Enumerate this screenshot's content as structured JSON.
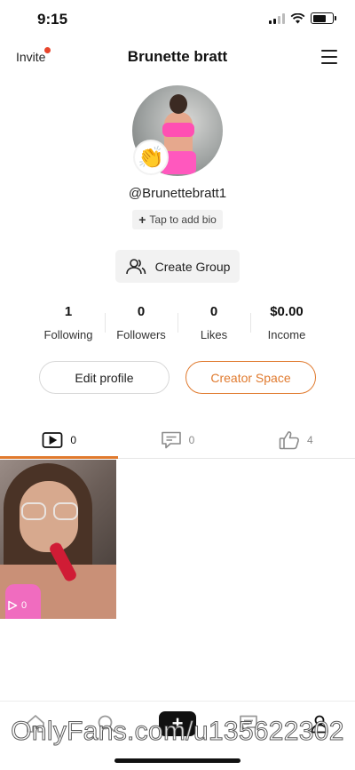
{
  "status_bar": {
    "time": "9:15"
  },
  "header": {
    "invite_label": "Invite",
    "title": "Brunette bratt"
  },
  "profile": {
    "handle": "@Brunettebratt1",
    "bio_button": "Tap to add bio",
    "bio_plus": "+",
    "badge_emoji": "👏"
  },
  "create_group": {
    "label": "Create Group"
  },
  "stats": [
    {
      "value": "1",
      "label": "Following"
    },
    {
      "value": "0",
      "label": "Followers"
    },
    {
      "value": "0",
      "label": "Likes"
    },
    {
      "value": "$0.00",
      "label": "Income"
    }
  ],
  "actions": {
    "edit_profile": "Edit profile",
    "creator_space": "Creator Space"
  },
  "tabs": [
    {
      "icon": "video-icon",
      "count": "0"
    },
    {
      "icon": "comment-icon",
      "count": "0"
    },
    {
      "icon": "thumbs-up-icon",
      "count": "4"
    }
  ],
  "videos": [
    {
      "play_count": "0"
    }
  ],
  "bottom_nav": [
    {
      "icon": "home-icon"
    },
    {
      "icon": "search-icon"
    },
    {
      "icon": "add-icon",
      "label": "+"
    },
    {
      "icon": "messages-icon"
    },
    {
      "icon": "profile-icon"
    }
  ],
  "watermark": "OnlyFans.com/u135622302",
  "colors": {
    "accent": "#e07a2e",
    "notification_dot": "#e8452c"
  }
}
